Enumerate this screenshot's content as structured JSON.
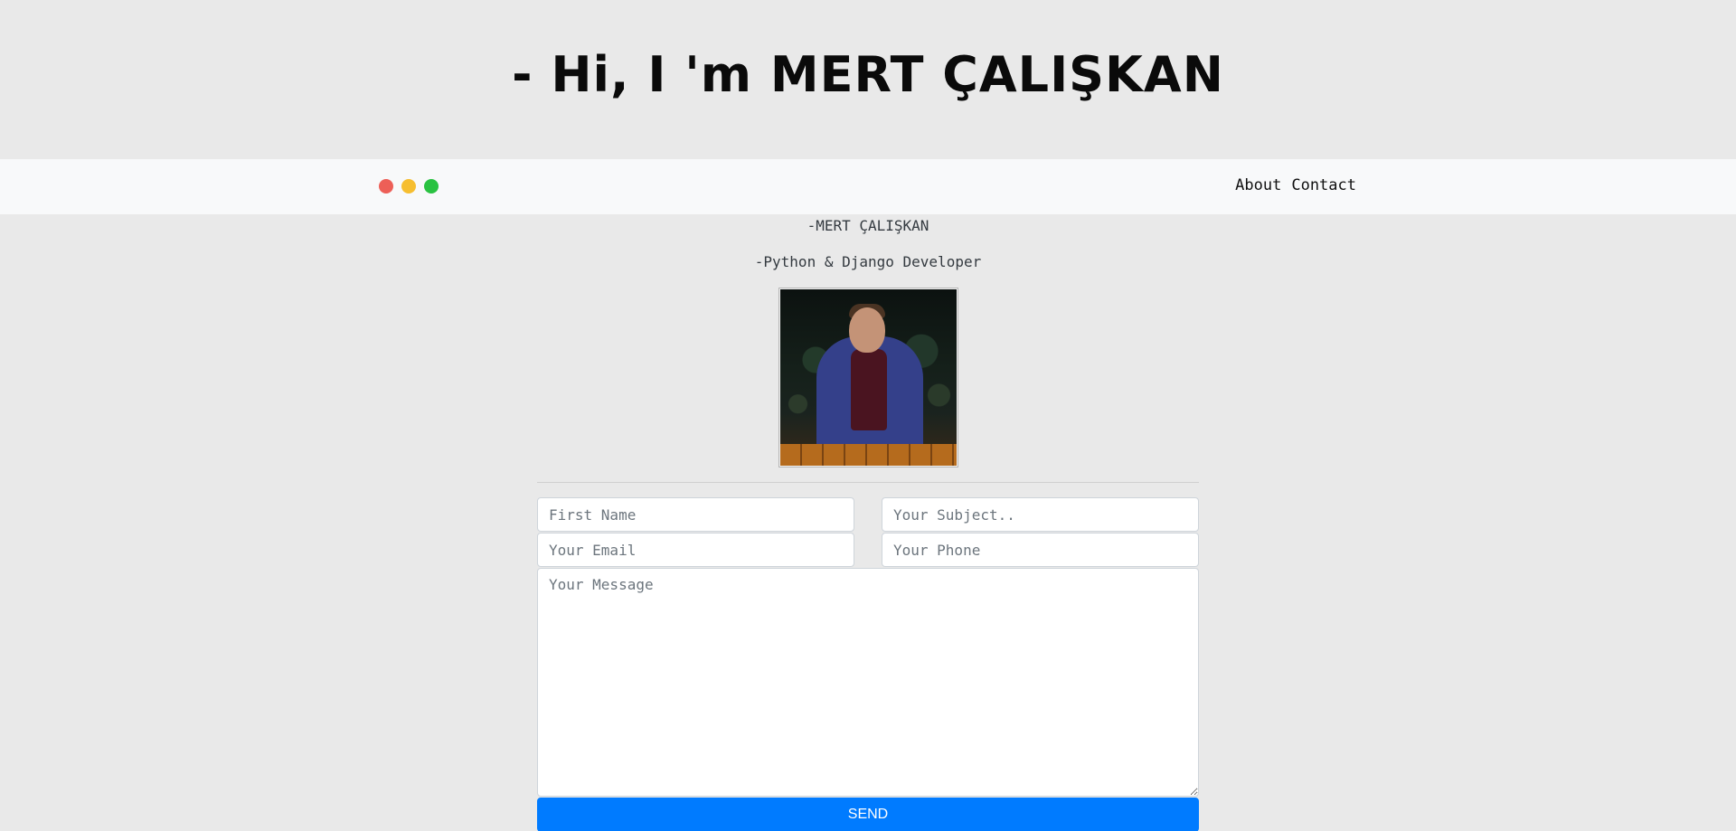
{
  "hero": {
    "title": "- Hi, I 'm MERT ÇALIŞKAN"
  },
  "navbar": {
    "window_controls": [
      {
        "name": "close",
        "color": "#ed5f57"
      },
      {
        "name": "minimize",
        "color": "#f6be30"
      },
      {
        "name": "maximize",
        "color": "#29c241"
      }
    ],
    "links": [
      {
        "label": "About"
      },
      {
        "label": "Contact"
      }
    ]
  },
  "profile": {
    "name": "-MERT ÇALIŞKAN",
    "role": "-Python & Django Developer"
  },
  "contact_form": {
    "first_name": {
      "placeholder": "First Name",
      "value": ""
    },
    "subject": {
      "placeholder": "Your Subject..",
      "value": ""
    },
    "email": {
      "placeholder": "Your Email",
      "value": ""
    },
    "phone": {
      "placeholder": "Your Phone",
      "value": ""
    },
    "message": {
      "placeholder": "Your Message",
      "value": ""
    },
    "send_label": "SEND",
    "send_color": "#007bff"
  }
}
